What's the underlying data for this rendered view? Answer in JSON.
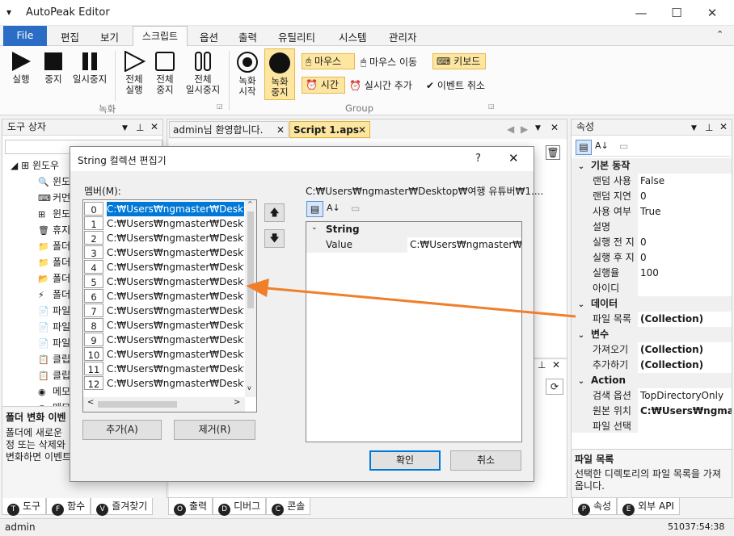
{
  "window": {
    "title": "AutoPeak Editor",
    "app_menu_glyph": "▾"
  },
  "menu": {
    "file": "File",
    "items": [
      "편집",
      "보기",
      "스크립트",
      "옵션",
      "출력",
      "유틸리티",
      "시스템",
      "관리자"
    ]
  },
  "ribbon": {
    "record_group_label": "녹화",
    "group_label": "Group",
    "run": "실행",
    "stop": "중지",
    "pause": "일시중지",
    "run_all_1": "전체",
    "run_all_2": "실행",
    "stop_all_1": "전체",
    "stop_all_2": "중지",
    "pause_all_1": "전체",
    "pause_all_2": "일시중지",
    "rec_start_1": "녹화",
    "rec_start_2": "시작",
    "rec_stop_1": "녹화",
    "rec_stop_2": "중지",
    "mouse": "마우스",
    "mouse_move": "마우스 이동",
    "keyboard": "키보드",
    "time": "시간",
    "realtime_add": "실시간 추가",
    "event_cancel": "이벤트 취소"
  },
  "toolbox": {
    "title": "도구 상자",
    "root_label": "윈도우",
    "items": [
      "윈도",
      "커먼",
      "윈도",
      "휴지",
      "폴더",
      "폴더",
      "폴더",
      "폴더",
      "파일",
      "파일",
      "파일",
      "클립",
      "클립",
      "메모",
      "메모"
    ],
    "desc_title": "폴더 변화 이벤",
    "desc_lines": [
      "폴더에 새로운",
      "정 또는 삭제와",
      "변화하면 이벤트"
    ],
    "tabs": [
      "도구",
      "함수",
      "즐겨찾기"
    ]
  },
  "editor": {
    "tabs": [
      "admin님 환영합니다.",
      "Script 1.aps"
    ]
  },
  "output": {
    "tabs": [
      "출력",
      "디버그",
      "콘솔"
    ]
  },
  "properties": {
    "title": "속성",
    "sections": [
      {
        "name": "기본 동작",
        "rows": [
          {
            "key": "랜덤 사용",
            "value": "False",
            "bold": false
          },
          {
            "key": "랜덤 지연",
            "value": "0",
            "bold": false
          },
          {
            "key": "사용 여부",
            "value": "True",
            "bold": false
          },
          {
            "key": "설명",
            "value": "",
            "bold": false
          },
          {
            "key": "실행 전 지",
            "value": "0",
            "bold": false
          },
          {
            "key": "실행 후 지",
            "value": "0",
            "bold": false
          },
          {
            "key": "실행율",
            "value": "100",
            "bold": false
          },
          {
            "key": "아이디",
            "value": "",
            "bold": false
          }
        ]
      },
      {
        "name": "데이터",
        "rows": [
          {
            "key": "파일 목록",
            "value": "(Collection)",
            "bold": true
          }
        ]
      },
      {
        "name": "변수",
        "rows": [
          {
            "key": "가져오기",
            "value": "(Collection)",
            "bold": true
          },
          {
            "key": "추가하기",
            "value": "(Collection)",
            "bold": true
          }
        ]
      },
      {
        "name": "Action",
        "rows": [
          {
            "key": "검색 옵션",
            "value": "TopDirectoryOnly",
            "bold": false
          },
          {
            "key": "원본 위치",
            "value": "C:₩Users₩ngmaste",
            "bold": true
          },
          {
            "key": "파일 선택",
            "value": "",
            "bold": false
          }
        ]
      }
    ],
    "desc_title": "파일 목록",
    "desc_text": "선택한 디렉토리의 파일 목록을 가져옵니다.",
    "tabs": [
      "속성",
      "외부 API"
    ]
  },
  "dialog": {
    "title": "String 컬렉션 편집기",
    "help": "?",
    "close": "✕",
    "members_label": "멤버(M):",
    "members": [
      {
        "index": "0",
        "path": "C:₩Users₩ngmaster₩Desktop"
      },
      {
        "index": "1",
        "path": "C:₩Users₩ngmaster₩Desktop"
      },
      {
        "index": "2",
        "path": "C:₩Users₩ngmaster₩Desktop"
      },
      {
        "index": "3",
        "path": "C:₩Users₩ngmaster₩Desktop"
      },
      {
        "index": "4",
        "path": "C:₩Users₩ngmaster₩Desktop"
      },
      {
        "index": "5",
        "path": "C:₩Users₩ngmaster₩Desktop"
      },
      {
        "index": "6",
        "path": "C:₩Users₩ngmaster₩Desktop"
      },
      {
        "index": "7",
        "path": "C:₩Users₩ngmaster₩Desktop"
      },
      {
        "index": "8",
        "path": "C:₩Users₩ngmaster₩Desktop"
      },
      {
        "index": "9",
        "path": "C:₩Users₩ngmaster₩Desktop"
      },
      {
        "index": "10",
        "path": "C:₩Users₩ngmaster₩Desktop"
      },
      {
        "index": "11",
        "path": "C:₩Users₩ngmaster₩Desktop"
      },
      {
        "index": "12",
        "path": "C:₩Users₩ngmaster₩Desktop"
      }
    ],
    "selected_path_header": "C:₩Users₩ngmaster₩Desktop₩여행 유튜버₩1....",
    "prop_section": "String",
    "prop_key": "Value",
    "prop_value": "C:₩Users₩ngmaster₩Desk",
    "add": "추가(A)",
    "remove": "제거(R)",
    "ok": "확인",
    "cancel": "취소"
  },
  "status": {
    "user": "admin",
    "time": "51037:54:38"
  },
  "colors": {
    "accent": "#2b6cc4",
    "arrow": "#f07f2a",
    "highlight": "#fde6a0"
  }
}
